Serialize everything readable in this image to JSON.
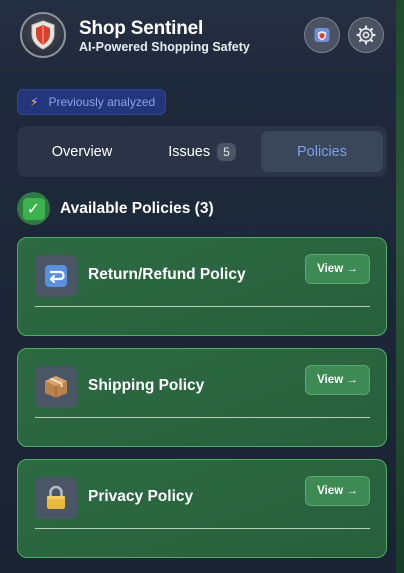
{
  "header": {
    "title": "Shop Sentinel",
    "subtitle": "AI-Powered Shopping Safety",
    "logo_icon": "shield-logo-icon",
    "buttons": [
      {
        "name": "shield-toggle-button",
        "icon": "shield-icon"
      },
      {
        "name": "settings-button",
        "icon": "gear-icon"
      }
    ]
  },
  "status_badge": {
    "icon": "lightning-icon",
    "label": "Previously analyzed"
  },
  "tabs": [
    {
      "label": "Overview",
      "active": false
    },
    {
      "label": "Issues",
      "count": "5",
      "active": false
    },
    {
      "label": "Policies",
      "active": true
    }
  ],
  "section": {
    "icon": "check-icon",
    "title": "Available Policies (3)"
  },
  "policies": [
    {
      "icon": "return-arrow-icon",
      "name": "Return/Refund Policy",
      "action": "View →"
    },
    {
      "icon": "package-icon",
      "name": "Shipping Policy",
      "action": "View →"
    },
    {
      "icon": "lock-icon",
      "name": "Privacy Policy",
      "action": "View →"
    }
  ],
  "colors": {
    "accent_blue": "#7da2ea",
    "card_green": "#2d6a42",
    "card_border": "#4fae66",
    "panel_bg": "#1f2a3c"
  }
}
